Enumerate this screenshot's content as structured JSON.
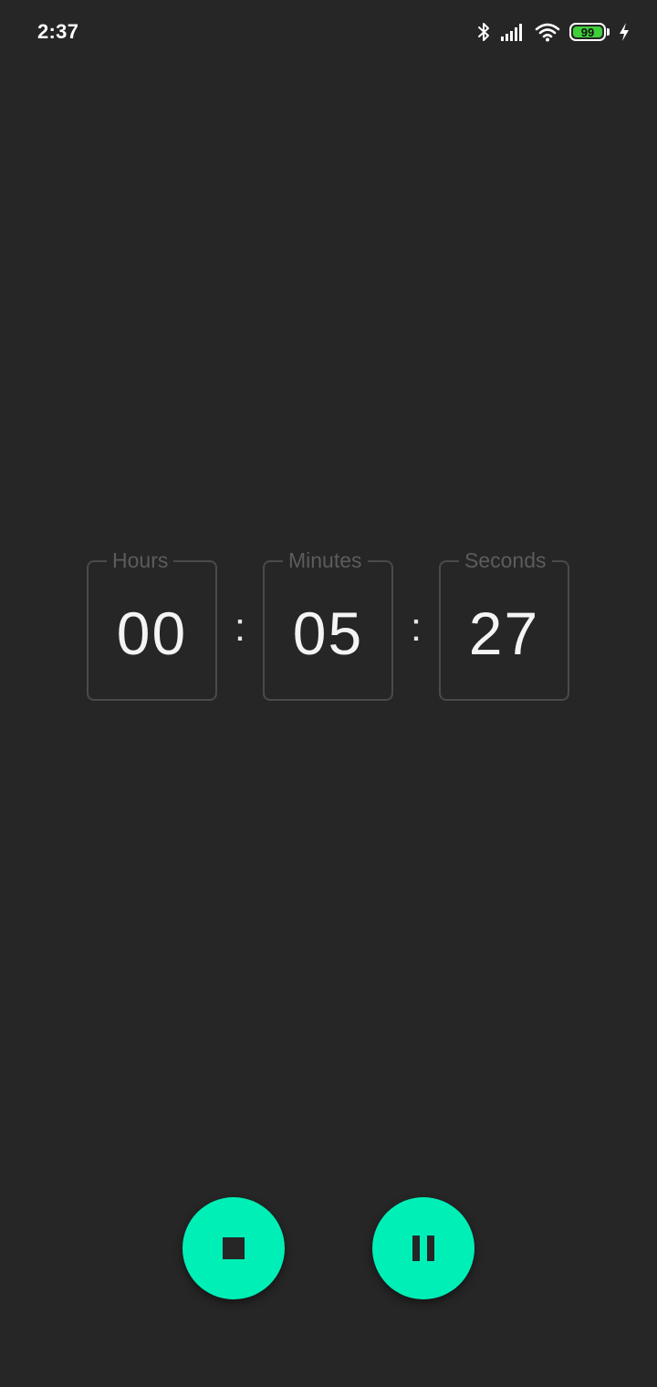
{
  "status_bar": {
    "time": "2:37",
    "battery_level": "99",
    "icons": [
      "bluetooth-icon",
      "signal-icon",
      "wifi-icon",
      "battery-icon",
      "charging-icon"
    ]
  },
  "timer": {
    "hours": {
      "label": "Hours",
      "value": "00"
    },
    "minutes": {
      "label": "Minutes",
      "value": "05"
    },
    "seconds": {
      "label": "Seconds",
      "value": "27"
    },
    "separator": ":"
  },
  "controls": {
    "stop_icon": "stop-icon",
    "pause_icon": "pause-icon",
    "accent_color": "#00efb7"
  },
  "colors": {
    "background": "#262626",
    "battery_fill": "#3fcf3a"
  }
}
